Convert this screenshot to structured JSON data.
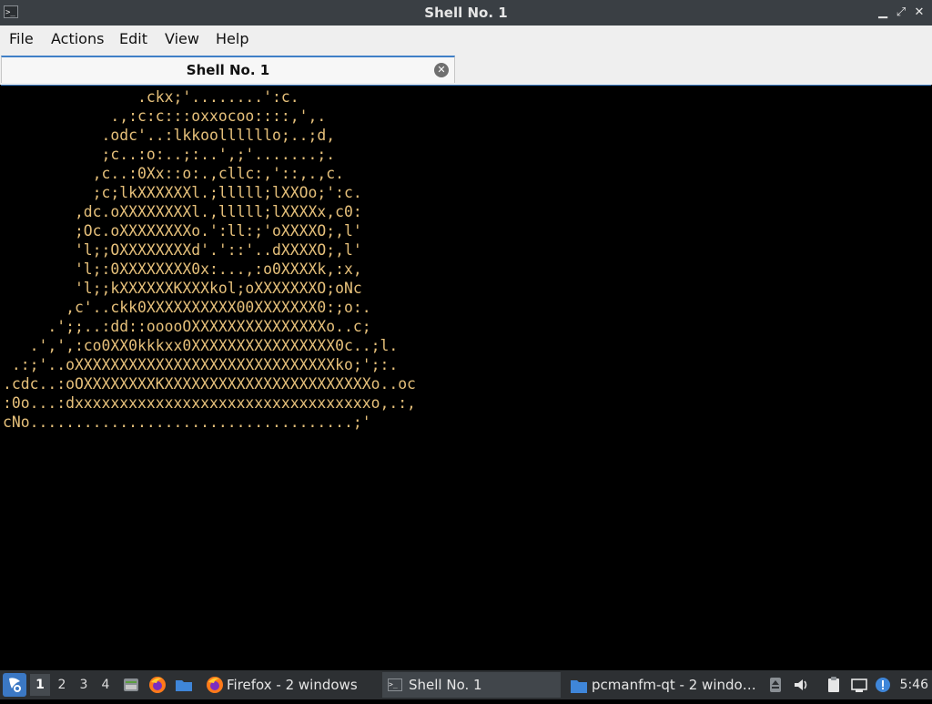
{
  "window": {
    "title": "Shell No. 1",
    "icon": "terminal-icon",
    "controls": {
      "minimize": "▁",
      "restore": "⤢",
      "close": "✕"
    }
  },
  "menu": [
    "File",
    "Actions",
    "Edit",
    "View",
    "Help"
  ],
  "tab": {
    "title": "Shell No. 1",
    "close_icon": "close-circle-icon"
  },
  "terminal": {
    "text_color": "#e6c07a",
    "background": "#000000",
    "lines": [
      "               .ckx;'........':c.",
      "            .,:c:c:::oxxocoo::::,',.",
      "           .odc'..:lkkoollllllo;..;d,",
      "           ;c..:o:..;:..',;'.......;.",
      "          ,c..:0Xx::o:.,cllc:,'::,.,c.",
      "          ;c;lkXXXXXXl.;lllll;lXXOo;':c.",
      "        ,dc.oXXXXXXXXl.,lllll;lXXXXx,c0:",
      "        ;Oc.oXXXXXXXXo.':ll:;'oXXXXO;,l'",
      "        'l;;OXXXXXXXXd'.'::'..dXXXXO;,l'",
      "        'l;:0XXXXXXXX0x:...,:o0XXXXk,:x,",
      "        'l;;kXXXXXXKXXXkol;oXXXXXXXO;oNc",
      "       ,c'..ckk0XXXXXXXXXX00XXXXXXX0:;o:.",
      "     .';;..:dd::ooooOXXXXXXXXXXXXXXXo..c;",
      "   .',',:co0XX0kkkxx0XXXXXXXXXXXXXXXX0c..;l.",
      " .:;'..oXXXXXXXXXXXXXXXXXXXXXXXXXXXXXko;';:.",
      ".cdc..:oOXXXXXXXXKXXXXXXXXXXXXXXXXXXXXXXXo..oc",
      ":0o...:dxxxxxxxxxxxxxxxxxxxxxxxxxxxxxxxxxo,.:,",
      "cNo....................................;'"
    ]
  },
  "taskbar": {
    "start_icon": "lubuntu-start-icon",
    "desktops": [
      "1",
      "2",
      "3",
      "4"
    ],
    "active_desktop": "1",
    "quicklaunch": [
      "file-manager-icon",
      "firefox-icon",
      "folder-icon"
    ],
    "tasks": [
      {
        "label": "Firefox - 2 windows",
        "icon": "firefox-icon",
        "active": false
      },
      {
        "label": "Shell No. 1",
        "icon": "terminal-icon",
        "active": true
      },
      {
        "label": "pcmanfm-qt - 2 windo…",
        "icon": "folder-icon",
        "active": false
      }
    ],
    "tray": [
      "eject-icon",
      "volume-icon",
      "clipboard-icon",
      "network-icon",
      "update-notifier-icon"
    ],
    "clock": "5:46"
  }
}
